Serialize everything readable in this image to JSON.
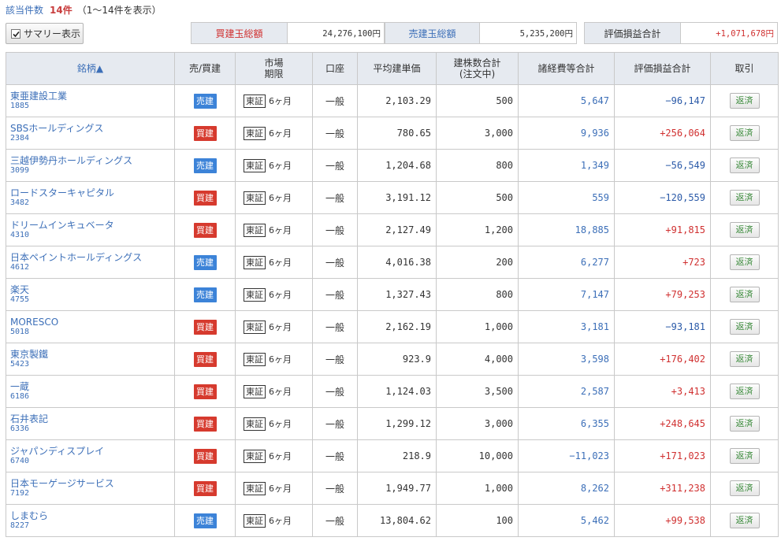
{
  "header": {
    "count_label": "該当件数",
    "count_value": "14件",
    "range_text": "（1～14件を表示）"
  },
  "summary_toggle": {
    "label": "サマリー表示",
    "checked": true
  },
  "summary": {
    "buy_total_label": "買建玉総額",
    "buy_total_value": "24,276,100円",
    "sell_total_label": "売建玉総額",
    "sell_total_value": "5,235,200円",
    "pnl_total_label": "評価損益合計",
    "pnl_total_value": "+1,071,678円"
  },
  "columns": {
    "name": "銘柄▲",
    "side": "売/買建",
    "market_l1": "市場",
    "market_l2": "期限",
    "account": "口座",
    "avg_price": "平均建単価",
    "qty_l1": "建株数合計",
    "qty_l2": "(注文中)",
    "fees": "諸経費等合計",
    "pnl": "評価損益合計",
    "action": "取引"
  },
  "rows": [
    {
      "name": "東亜建設工業",
      "code": "1885",
      "side": "売建",
      "side_type": "sell",
      "market": "東証",
      "period": "6ヶ月",
      "account": "一般",
      "avg_price": "2,103.29",
      "qty": "500",
      "fees": "5,647",
      "pnl": "−96,147",
      "pnl_sign": "neg",
      "action": "返済"
    },
    {
      "name": "SBSホールディングス",
      "code": "2384",
      "side": "買建",
      "side_type": "buy",
      "market": "東証",
      "period": "6ヶ月",
      "account": "一般",
      "avg_price": "780.65",
      "qty": "3,000",
      "fees": "9,936",
      "pnl": "+256,064",
      "pnl_sign": "pos",
      "action": "返済"
    },
    {
      "name": "三越伊勢丹ホールディングス",
      "code": "3099",
      "side": "売建",
      "side_type": "sell",
      "market": "東証",
      "period": "6ヶ月",
      "account": "一般",
      "avg_price": "1,204.68",
      "qty": "800",
      "fees": "1,349",
      "pnl": "−56,549",
      "pnl_sign": "neg",
      "action": "返済"
    },
    {
      "name": "ロードスターキャピタル",
      "code": "3482",
      "side": "買建",
      "side_type": "buy",
      "market": "東証",
      "period": "6ヶ月",
      "account": "一般",
      "avg_price": "3,191.12",
      "qty": "500",
      "fees": "559",
      "pnl": "−120,559",
      "pnl_sign": "neg",
      "action": "返済"
    },
    {
      "name": "ドリームインキュベータ",
      "code": "4310",
      "side": "買建",
      "side_type": "buy",
      "market": "東証",
      "period": "6ヶ月",
      "account": "一般",
      "avg_price": "2,127.49",
      "qty": "1,200",
      "fees": "18,885",
      "pnl": "+91,815",
      "pnl_sign": "pos",
      "action": "返済"
    },
    {
      "name": "日本ペイントホールディングス",
      "code": "4612",
      "side": "売建",
      "side_type": "sell",
      "market": "東証",
      "period": "6ヶ月",
      "account": "一般",
      "avg_price": "4,016.38",
      "qty": "200",
      "fees": "6,277",
      "pnl": "+723",
      "pnl_sign": "pos",
      "action": "返済"
    },
    {
      "name": "楽天",
      "code": "4755",
      "side": "売建",
      "side_type": "sell",
      "market": "東証",
      "period": "6ヶ月",
      "account": "一般",
      "avg_price": "1,327.43",
      "qty": "800",
      "fees": "7,147",
      "pnl": "+79,253",
      "pnl_sign": "pos",
      "action": "返済"
    },
    {
      "name": "MORESCO",
      "code": "5018",
      "side": "買建",
      "side_type": "buy",
      "market": "東証",
      "period": "6ヶ月",
      "account": "一般",
      "avg_price": "2,162.19",
      "qty": "1,000",
      "fees": "3,181",
      "pnl": "−93,181",
      "pnl_sign": "neg",
      "action": "返済"
    },
    {
      "name": "東京製鐵",
      "code": "5423",
      "side": "買建",
      "side_type": "buy",
      "market": "東証",
      "period": "6ヶ月",
      "account": "一般",
      "avg_price": "923.9",
      "qty": "4,000",
      "fees": "3,598",
      "pnl": "+176,402",
      "pnl_sign": "pos",
      "action": "返済"
    },
    {
      "name": "一蔵",
      "code": "6186",
      "side": "買建",
      "side_type": "buy",
      "market": "東証",
      "period": "6ヶ月",
      "account": "一般",
      "avg_price": "1,124.03",
      "qty": "3,500",
      "fees": "2,587",
      "pnl": "+3,413",
      "pnl_sign": "pos",
      "action": "返済"
    },
    {
      "name": "石井表記",
      "code": "6336",
      "side": "買建",
      "side_type": "buy",
      "market": "東証",
      "period": "6ヶ月",
      "account": "一般",
      "avg_price": "1,299.12",
      "qty": "3,000",
      "fees": "6,355",
      "pnl": "+248,645",
      "pnl_sign": "pos",
      "action": "返済"
    },
    {
      "name": "ジャパンディスプレイ",
      "code": "6740",
      "side": "買建",
      "side_type": "buy",
      "market": "東証",
      "period": "6ヶ月",
      "account": "一般",
      "avg_price": "218.9",
      "qty": "10,000",
      "fees": "−11,023",
      "pnl": "+171,023",
      "pnl_sign": "pos",
      "action": "返済"
    },
    {
      "name": "日本モーゲージサービス",
      "code": "7192",
      "side": "買建",
      "side_type": "buy",
      "market": "東証",
      "period": "6ヶ月",
      "account": "一般",
      "avg_price": "1,949.77",
      "qty": "1,000",
      "fees": "8,262",
      "pnl": "+311,238",
      "pnl_sign": "pos",
      "action": "返済"
    },
    {
      "name": "しまむら",
      "code": "8227",
      "side": "売建",
      "side_type": "sell",
      "market": "東証",
      "period": "6ヶ月",
      "account": "一般",
      "avg_price": "13,804.62",
      "qty": "100",
      "fees": "5,462",
      "pnl": "+99,538",
      "pnl_sign": "pos",
      "action": "返済"
    }
  ]
}
